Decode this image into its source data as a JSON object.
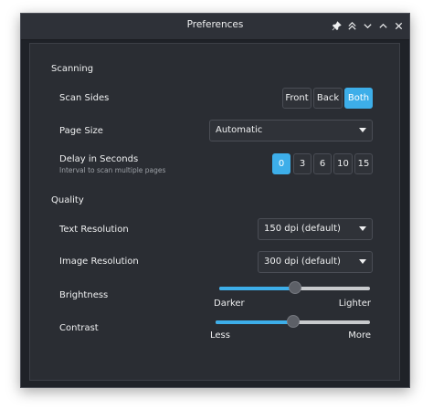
{
  "window": {
    "title": "Preferences"
  },
  "titlebar_buttons": [
    "pin-icon",
    "keep-above-icon",
    "keep-below-icon",
    "maximize-icon",
    "close-icon"
  ],
  "scanning": {
    "title": "Scanning",
    "sides": {
      "label": "Scan Sides",
      "options": [
        "Front",
        "Back",
        "Both"
      ],
      "selected": "Both"
    },
    "page_size": {
      "label": "Page Size",
      "value": "Automatic"
    },
    "delay": {
      "label": "Delay in Seconds",
      "hint": "Interval to scan multiple pages",
      "options": [
        "0",
        "3",
        "6",
        "10",
        "15"
      ],
      "selected": "0"
    }
  },
  "quality": {
    "title": "Quality",
    "text_resolution": {
      "label": "Text Resolution",
      "value": "150 dpi (default)"
    },
    "image_resolution": {
      "label": "Image Resolution",
      "value": "300 dpi (default)"
    },
    "brightness": {
      "label": "Brightness",
      "min_label": "Darker",
      "max_label": "Lighter",
      "level": 0.5
    },
    "contrast": {
      "label": "Contrast",
      "min_label": "Less",
      "max_label": "More",
      "level": 0.5
    }
  },
  "colors": {
    "accent": "#3daee9",
    "background": "#2a2d33"
  }
}
